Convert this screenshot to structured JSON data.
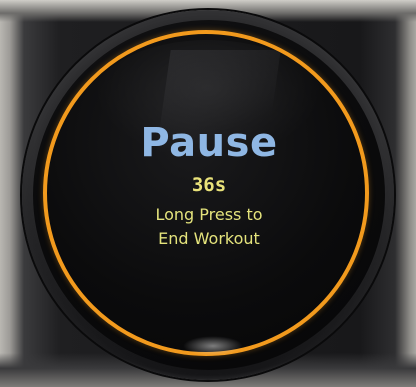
{
  "screen": {
    "title": "Pause",
    "countdown": "36s",
    "hint_line_1": "Long Press to",
    "hint_line_2": "End Workout"
  },
  "colors": {
    "title": "#8fb7e4",
    "hint_text": "#e4e37c",
    "ring": "#f29a1d",
    "screen_bg": "#0b0b0c"
  }
}
